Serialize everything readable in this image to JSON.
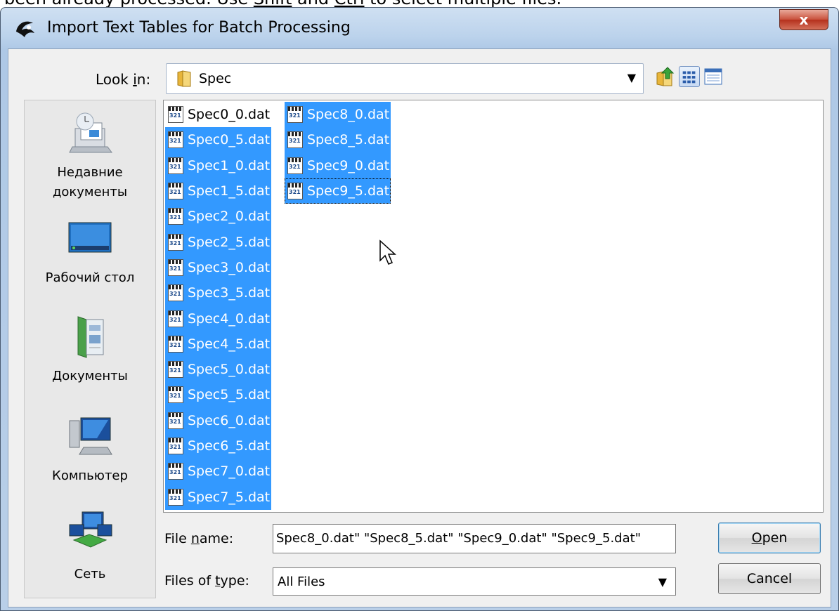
{
  "background_caption": {
    "prefix": "been already processed. Use ",
    "key1": "Shift",
    "middle": " and ",
    "key2": "Ctrl",
    "suffix": " to select multiple files."
  },
  "window": {
    "title": "Import Text Tables for Batch Processing",
    "close_label": "x"
  },
  "look_in": {
    "label_pre": "Look ",
    "label_ul": "i",
    "label_post": "n:",
    "value": "Spec"
  },
  "places": [
    {
      "label": "Недавние документы",
      "icon": "recent-documents-icon"
    },
    {
      "label": "Рабочий стол",
      "icon": "desktop-icon"
    },
    {
      "label": "Документы",
      "icon": "documents-icon"
    },
    {
      "label": "Компьютер",
      "icon": "computer-icon"
    },
    {
      "label": "Сеть",
      "icon": "network-icon"
    }
  ],
  "files_col1": [
    {
      "name": "Spec0_0.dat",
      "selected": false
    },
    {
      "name": "Spec0_5.dat",
      "selected": true
    },
    {
      "name": "Spec1_0.dat",
      "selected": true
    },
    {
      "name": "Spec1_5.dat",
      "selected": true
    },
    {
      "name": "Spec2_0.dat",
      "selected": true
    },
    {
      "name": "Spec2_5.dat",
      "selected": true
    },
    {
      "name": "Spec3_0.dat",
      "selected": true
    },
    {
      "name": "Spec3_5.dat",
      "selected": true
    },
    {
      "name": "Spec4_0.dat",
      "selected": true
    },
    {
      "name": "Spec4_5.dat",
      "selected": true
    },
    {
      "name": "Spec5_0.dat",
      "selected": true
    },
    {
      "name": "Spec5_5.dat",
      "selected": true
    },
    {
      "name": "Spec6_0.dat",
      "selected": true
    },
    {
      "name": "Spec6_5.dat",
      "selected": true
    },
    {
      "name": "Spec7_0.dat",
      "selected": true
    },
    {
      "name": "Spec7_5.dat",
      "selected": true
    }
  ],
  "files_col2": [
    {
      "name": "Spec8_0.dat",
      "selected": true
    },
    {
      "name": "Spec8_5.dat",
      "selected": true
    },
    {
      "name": "Spec9_0.dat",
      "selected": true
    },
    {
      "name": "Spec9_5.dat",
      "selected": true
    }
  ],
  "file_name": {
    "label_pre": "File ",
    "label_ul": "n",
    "label_post": "ame:",
    "value": "Spec8_0.dat\" \"Spec8_5.dat\" \"Spec9_0.dat\" \"Spec9_5.dat\""
  },
  "file_type": {
    "label_pre": "Files of ",
    "label_ul": "t",
    "label_post": "ype:",
    "value": "All Files"
  },
  "buttons": {
    "open_ul": "O",
    "open_rest": "pen",
    "cancel": "Cancel"
  },
  "colors": {
    "selection": "#3399ff",
    "frame": "#bcd3ec"
  }
}
